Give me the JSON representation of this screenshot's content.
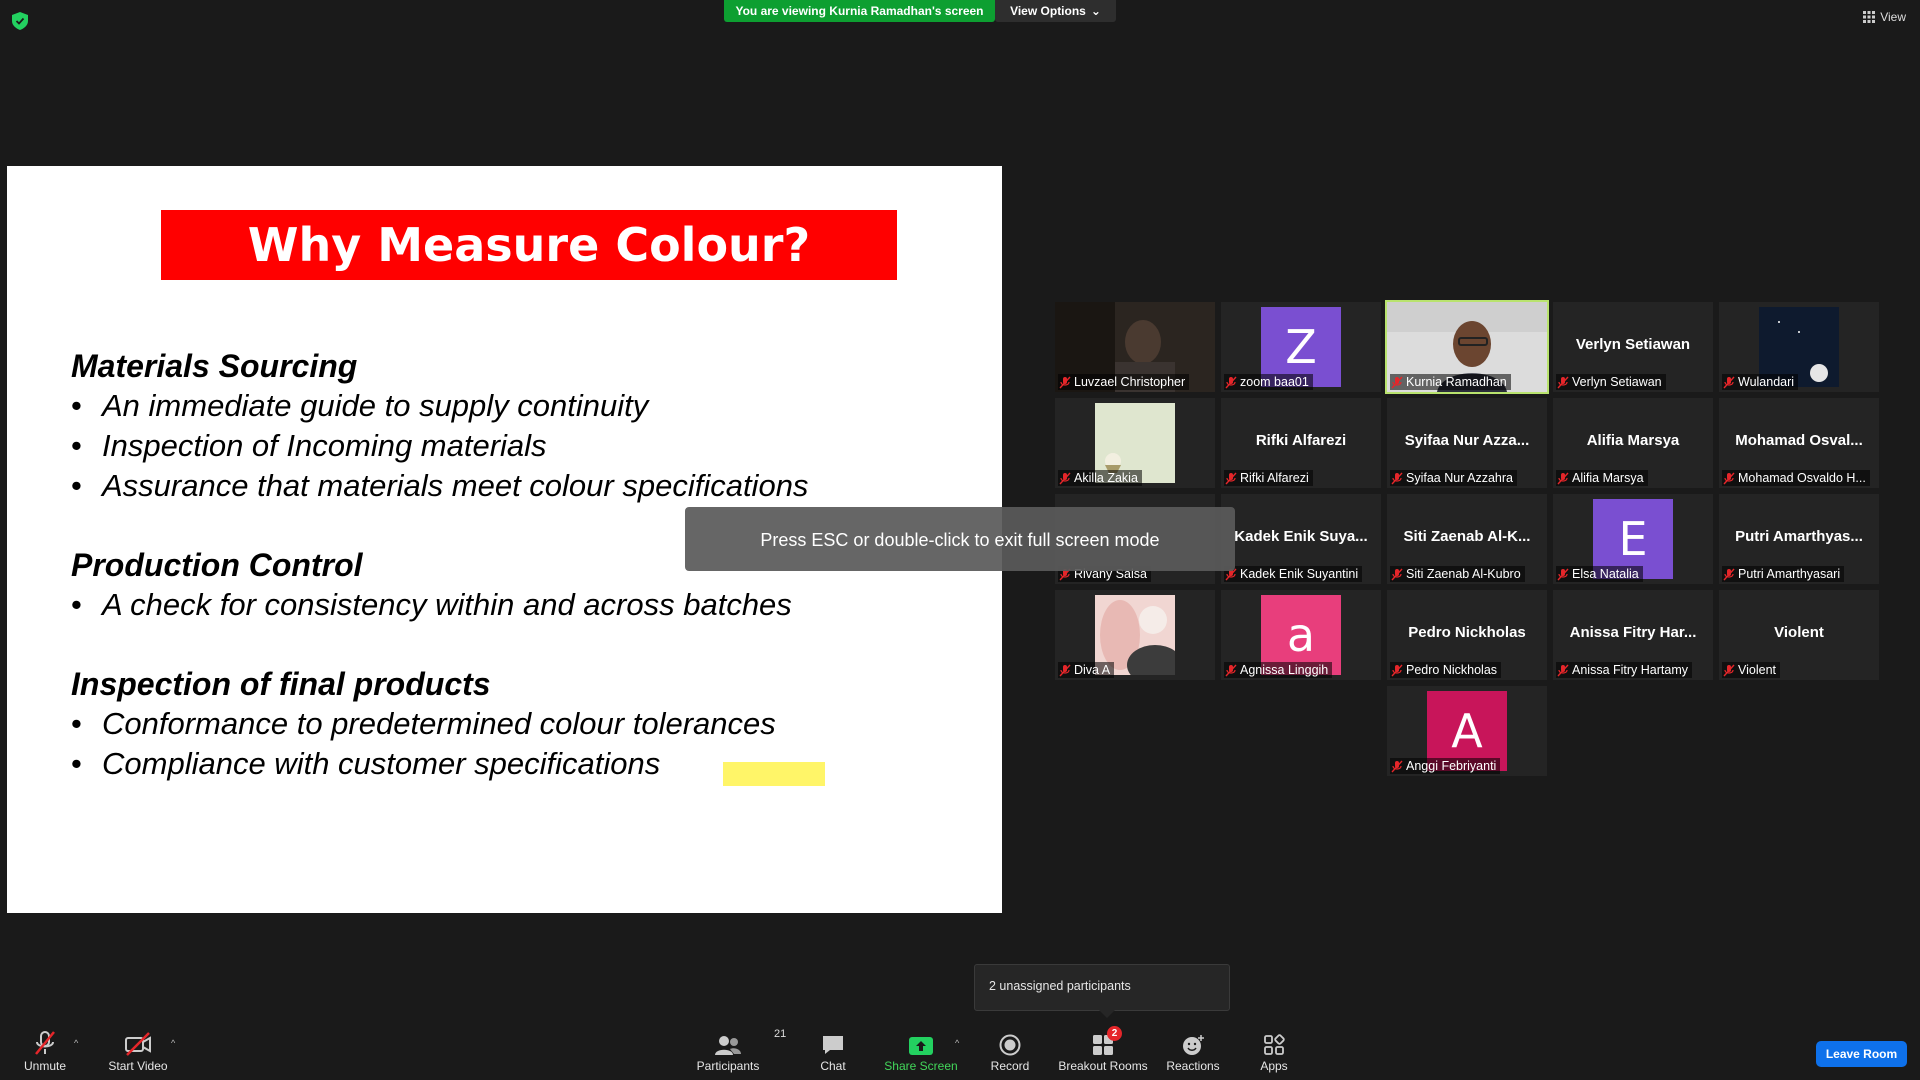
{
  "top": {
    "viewing_banner": "You are viewing Kurnia Ramadhan's screen",
    "view_options": "View Options",
    "view": "View"
  },
  "slide": {
    "title": "Why Measure Colour?",
    "sections": [
      {
        "heading": "Materials Sourcing",
        "bullets": [
          "An immediate guide to supply continuity",
          "Inspection of Incoming materials",
          "Assurance that materials meet colour specifications"
        ]
      },
      {
        "heading": "Production Control",
        "bullets": [
          "A check for consistency within and across batches"
        ]
      },
      {
        "heading": "Inspection of final products",
        "bullets": [
          "Conformance to predetermined colour tolerances",
          "Compliance with customer specifications"
        ]
      }
    ]
  },
  "fullscreen_hint": "Press ESC or double-click to exit full screen mode",
  "participants": [
    {
      "label": "Luvzael Christopher",
      "type": "video"
    },
    {
      "label": "zoom baa01",
      "type": "avatar",
      "initial": "Z",
      "color": "#7a4fd1"
    },
    {
      "label": "Kurnia Ramadhan",
      "type": "video",
      "active": true
    },
    {
      "label": "Verlyn Setiawan",
      "type": "name",
      "big_name": "Verlyn Setiawan"
    },
    {
      "label": "Wulandari",
      "type": "photo"
    },
    {
      "label": "Akilla Zakia",
      "type": "photo"
    },
    {
      "label": "Rifki Alfarezi",
      "type": "name",
      "big_name": "Rifki Alfarezi"
    },
    {
      "label": "Syifaa Nur Azzahra",
      "type": "name",
      "big_name": "Syifaa Nur Azza..."
    },
    {
      "label": "Alifia Marsya",
      "type": "name",
      "big_name": "Alifia Marsya"
    },
    {
      "label": "Mohamad Osvaldo H...",
      "type": "name",
      "big_name": "Mohamad Osval..."
    },
    {
      "label": "Rivany Salsa",
      "type": "name",
      "big_name": ""
    },
    {
      "label": "Kadek Enik Suyantini",
      "type": "name",
      "big_name": "Kadek Enik Suya..."
    },
    {
      "label": "Siti Zaenab Al-Kubro",
      "type": "name",
      "big_name": "Siti Zaenab Al-K..."
    },
    {
      "label": "Elsa Natalia",
      "type": "avatar",
      "initial": "E",
      "color": "#7a4fd1"
    },
    {
      "label": "Putri Amarthyasari",
      "type": "name",
      "big_name": "Putri Amarthyas..."
    },
    {
      "label": "Diva A",
      "type": "photo"
    },
    {
      "label": "Agnissa Linggih",
      "type": "avatar",
      "initial": "a",
      "color": "#e83e7c"
    },
    {
      "label": "Pedro Nickholas",
      "type": "name",
      "big_name": "Pedro Nickholas"
    },
    {
      "label": "Anissa Fitry Hartamy",
      "type": "name",
      "big_name": "Anissa Fitry Har..."
    },
    {
      "label": "Violent",
      "type": "name",
      "big_name": "Violent"
    },
    {
      "label": "Anggi Febriyanti",
      "type": "avatar",
      "initial": "A",
      "color": "#c8155a"
    }
  ],
  "toolbar": {
    "unmute": "Unmute",
    "start_video": "Start Video",
    "participants": "Participants",
    "participants_count": "21",
    "chat": "Chat",
    "share_screen": "Share Screen",
    "record": "Record",
    "breakout_rooms": "Breakout Rooms",
    "breakout_badge": "2",
    "reactions": "Reactions",
    "apps": "Apps",
    "leave_room": "Leave Room"
  },
  "tooltip": "2 unassigned participants"
}
